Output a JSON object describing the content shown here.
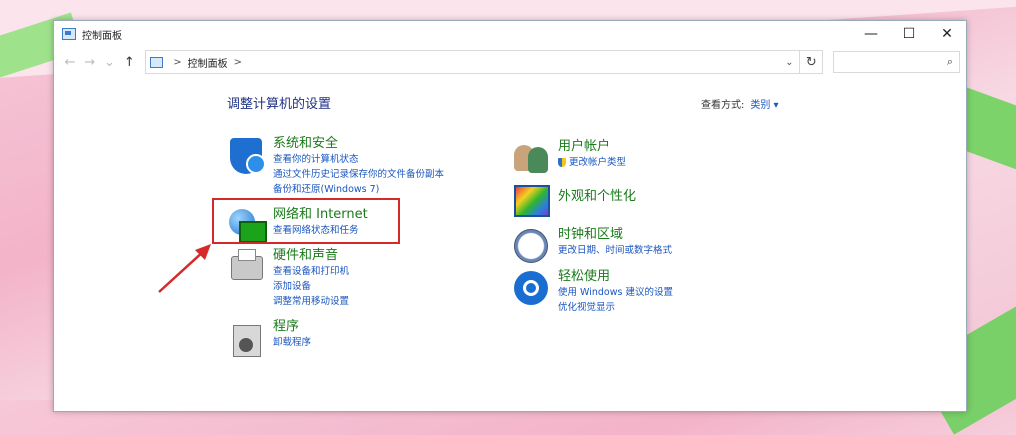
{
  "window": {
    "title": "控制面板",
    "minimize": "—",
    "maximize": "☐",
    "close": "✕"
  },
  "address": {
    "back": "←",
    "forward": "→",
    "recent": "⌄",
    "up": "↑",
    "separator_start": ">",
    "crumb": "控制面板",
    "separator_end": ">",
    "dropdown": "⌄",
    "refresh": "↻",
    "search_icon": "⌕"
  },
  "main": {
    "heading": "调整计算机的设置",
    "view_label": "查看方式:",
    "view_value": "类别 ▾"
  },
  "categories": [
    {
      "title": "系统和安全",
      "icon": "shield-icon",
      "links": [
        "查看你的计算机状态",
        "通过文件历史记录保存你的文件备份副本",
        "备份和还原(Windows 7)"
      ]
    },
    {
      "title": "网络和 Internet",
      "icon": "network-globe-icon",
      "links": [
        "查看网络状态和任务"
      ]
    },
    {
      "title": "硬件和声音",
      "icon": "printer-icon",
      "links": [
        "查看设备和打印机",
        "添加设备",
        "调整常用移动设置"
      ]
    },
    {
      "title": "程序",
      "icon": "programs-icon",
      "links": [
        "卸载程序"
      ]
    },
    {
      "title": "用户帐户",
      "icon": "users-icon",
      "links": [
        "更改帐户类型"
      ]
    },
    {
      "title": "外观和个性化",
      "icon": "appearance-icon",
      "links": []
    },
    {
      "title": "时钟和区域",
      "icon": "clock-icon",
      "links": [
        "更改日期、时间或数字格式"
      ]
    },
    {
      "title": "轻松使用",
      "icon": "ease-of-access-icon",
      "links": [
        "使用 Windows 建议的设置",
        "优化视觉显示"
      ]
    }
  ],
  "annotation_color": "#d42a2a"
}
